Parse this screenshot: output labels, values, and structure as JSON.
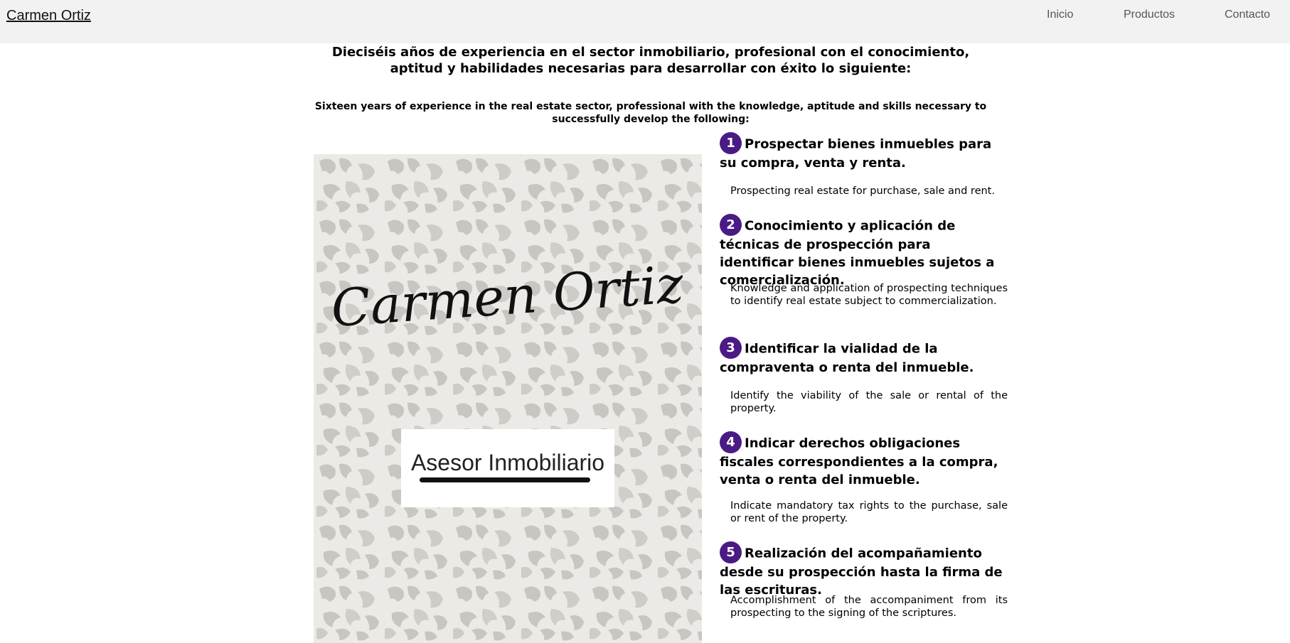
{
  "brand": "Carmen Ortiz",
  "nav": {
    "inicio": "Inicio",
    "productos": "Productos",
    "contacto": "Contacto"
  },
  "intro": {
    "es": "Dieciséis años de experiencia en el sector inmobiliario, profesional con el conocimiento, aptitud y habilidades necesarias para desarrollar con éxito lo siguiente:",
    "en": "Sixteen years of experience in the real estate sector, professional with the knowledge, aptitude and skills necessary to successfully develop the following:"
  },
  "image": {
    "script_name": "Carmen Ortiz",
    "caption": "Asesor Inmobiliario"
  },
  "items": [
    {
      "num": "1",
      "es": "Prospectar bienes inmuebles para su compra, venta y renta.",
      "en": "Prospecting real estate for purchase, sale and rent."
    },
    {
      "num": "2",
      "es": "Conocimiento y aplicación de técnicas de prospección para identificar bienes inmuebles sujetos a comercialización.",
      "en": "Knowledge and application of prospecting techniques to identify real estate subject to commercialization."
    },
    {
      "num": "3",
      "es": "Identificar la vialidad de la compraventa o renta del inmueble.",
      "en": "Identify the viability of the sale or rental of the property."
    },
    {
      "num": "4",
      "es": "Indicar derechos obligaciones fiscales correspondientes a la compra, venta o renta del inmueble.",
      "en": "Indicate mandatory tax rights to the purchase, sale or rent of the property."
    },
    {
      "num": "5",
      "es": "Realización del acompañamiento desde su prospección hasta la firma de las escrituras.",
      "en": "Accomplishment of the accompaniment from its prospecting to the signing of the scriptures."
    }
  ],
  "colors": {
    "badge": "#4a1a85",
    "topbar": "#f2f2f2",
    "leopard": "#c9c5c0"
  }
}
